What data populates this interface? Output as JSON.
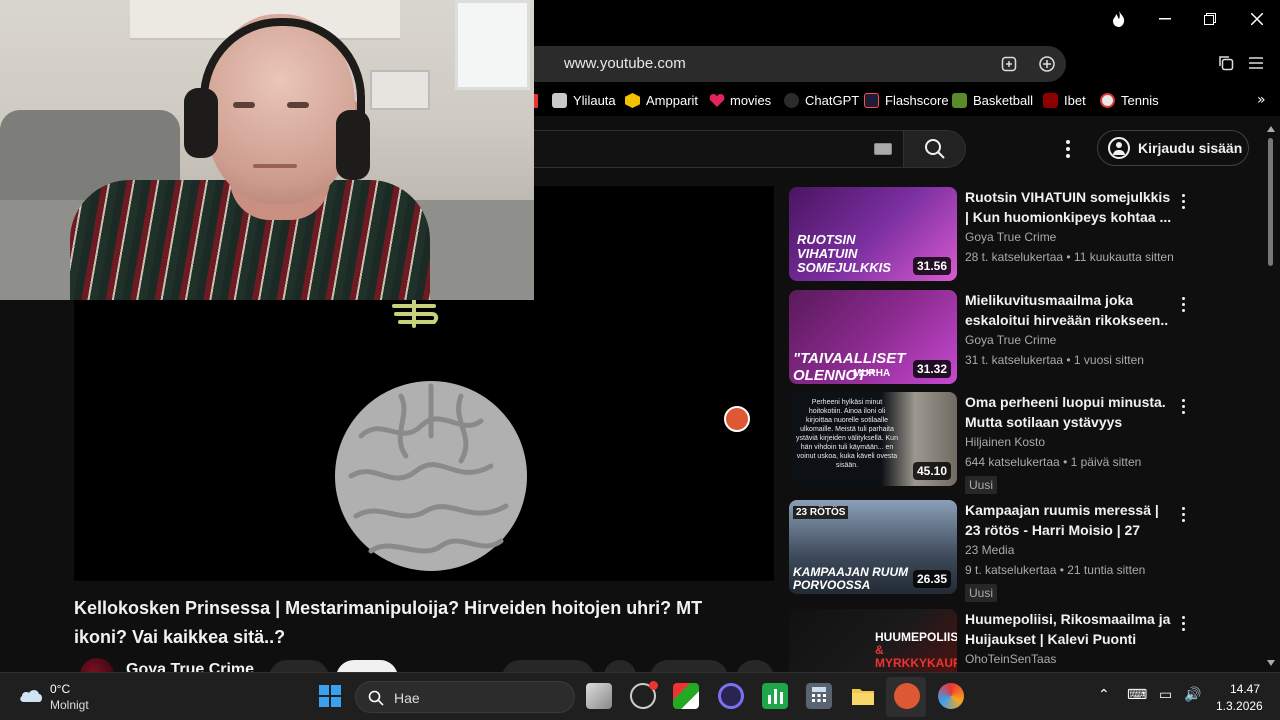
{
  "browser": {
    "url": "www.youtube.com",
    "bookmarks": [
      {
        "label": "Ylilauta",
        "color": "#c9c9c9"
      },
      {
        "label": "Ampparit",
        "color": "#f2c200"
      },
      {
        "label": "movies",
        "color": "#e0245e"
      },
      {
        "label": "ChatGPT",
        "color": "#2b2b2b"
      },
      {
        "label": "Flashscore",
        "color": "#1d1d3a"
      },
      {
        "label": "Basketball",
        "color": "#5a8a2a"
      },
      {
        "label": "Ibet",
        "color": "#8b0000"
      },
      {
        "label": "Tennis",
        "color": "#e8e8e8"
      }
    ]
  },
  "youtube": {
    "signin_label": "Kirjaudu sisään",
    "video": {
      "title": "Kellokosken Prinsessa | Mestarimanipuloija? Hirveiden hoitojen uhri? MT ikoni? Vai kaikkea sitä..?",
      "channel": "Goya True Crime"
    },
    "recommendations": [
      {
        "title": "Ruotsin VIHATUIN somejulkkis | Kun huomionkipeys kohtaa ...",
        "channel": "Goya True Crime",
        "meta": "28 t. katselukertaa • 11 kuukautta sitten",
        "duration": "31.56",
        "badge": "",
        "thumb_color": "#7a2fa0"
      },
      {
        "title": "Mielikuvitusmaailma joka eskaloitui hirveään rikokseen..",
        "channel": "Goya True Crime",
        "meta": "31 t. katselukertaa • 1 vuosi sitten",
        "duration": "31.32",
        "badge": "",
        "thumb_color": "#8a2a8f"
      },
      {
        "title": "Oma perheeni luopui minusta. Mutta sotilaan ystävyys pelast...",
        "channel": "Hiljainen Kosto",
        "meta": "644 katselukertaa • 1 päivä sitten",
        "duration": "45.10",
        "badge": "Uusi",
        "thumb_color": "#101418"
      },
      {
        "title": "Kampaajan ruumis meressä | 23 rötös - Harri Moisio | 27",
        "channel": "23 Media",
        "meta": "9 t. katselukertaa • 21 tuntia sitten",
        "duration": "26.35",
        "badge": "Uusi",
        "thumb_color": "#3d4a5a"
      },
      {
        "title": "Huumepoliisi, Rikosmaailma ja Huijaukset | Kalevi Puonti",
        "channel": "OhoTeinSenTaas",
        "meta": "",
        "duration": "",
        "badge": "",
        "thumb_color": "#1a1a1a"
      }
    ]
  },
  "taskbar": {
    "weather_temp": "0°C",
    "weather_desc": "Molnigt",
    "search_label": "Hae",
    "time": "14.47",
    "date": "1.3.2026"
  }
}
